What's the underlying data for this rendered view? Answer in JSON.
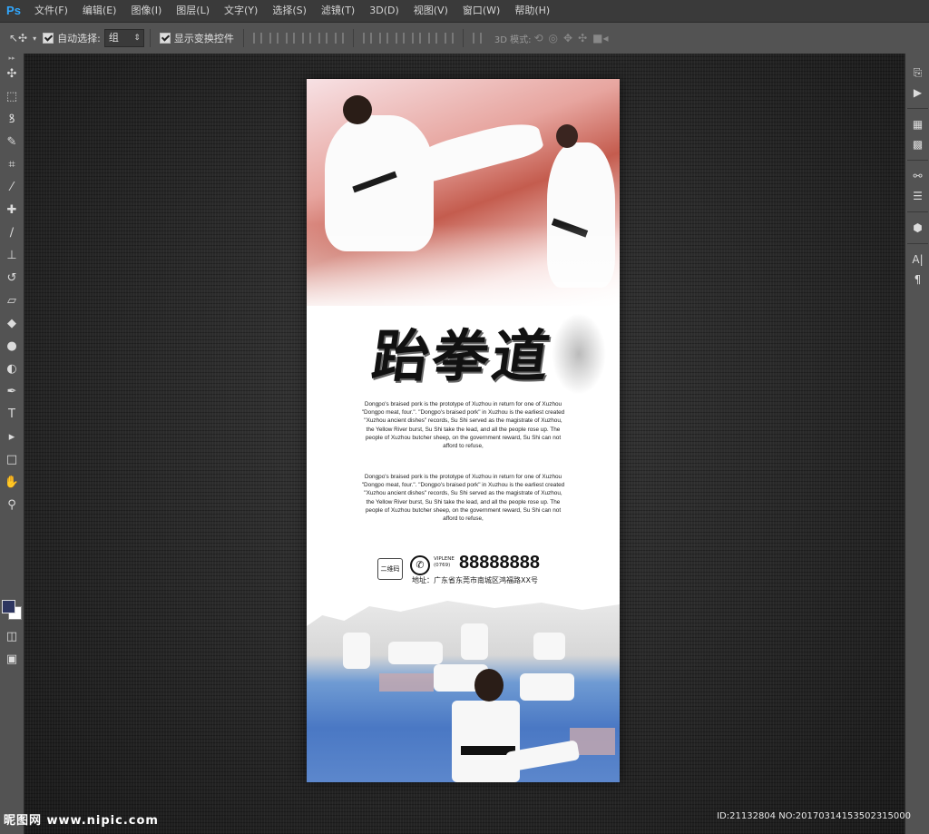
{
  "app": {
    "logo": "Ps"
  },
  "menu": [
    "文件(F)",
    "编辑(E)",
    "图像(I)",
    "图层(L)",
    "文字(Y)",
    "选择(S)",
    "滤镜(T)",
    "3D(D)",
    "视图(V)",
    "窗口(W)",
    "帮助(H)"
  ],
  "options": {
    "auto_select_label": "自动选择:",
    "auto_select_value": "组",
    "show_transform_label": "显示变换控件",
    "mode_3d_label": "3D 模式:"
  },
  "tools": [
    "move-icon",
    "marquee-icon",
    "lasso-icon",
    "quick-select-icon",
    "crop-icon",
    "eyedropper-icon",
    "healing-icon",
    "brush-icon",
    "stamp-icon",
    "history-brush-icon",
    "eraser-icon",
    "bucket-icon",
    "blur-icon",
    "dodge-icon",
    "pen-icon",
    "type-icon",
    "path-select-icon",
    "shape-icon",
    "hand-icon",
    "zoom-icon"
  ],
  "poster": {
    "title": "跆拳道",
    "paragraph": "Dongpo's braised pork is the prototype of Xuzhou in return for one of Xuzhou \"Dongpo meat, four.\". \"Dongpo's braised pork\" in Xuzhou is the earliest created \"Xuzhou ancient dishes\" records, Su Shi served as the magistrate of Xuzhou, the Yellow River burst, Su Shi take the lead, and all the people rose up. The people of Xuzhou butcher sheep, on the government reward, Su Shi can not afford to refuse,",
    "qr_label": "二维码",
    "vip_label": "VIPLENE",
    "area_code": "(0769)",
    "phone": "88888888",
    "address": "地址：广东省东莞市南城区鸿福路XX号"
  },
  "watermark": {
    "site": "昵图网 www.nipic.com",
    "id": "ID:21132804 NO:20170314153502315000"
  }
}
